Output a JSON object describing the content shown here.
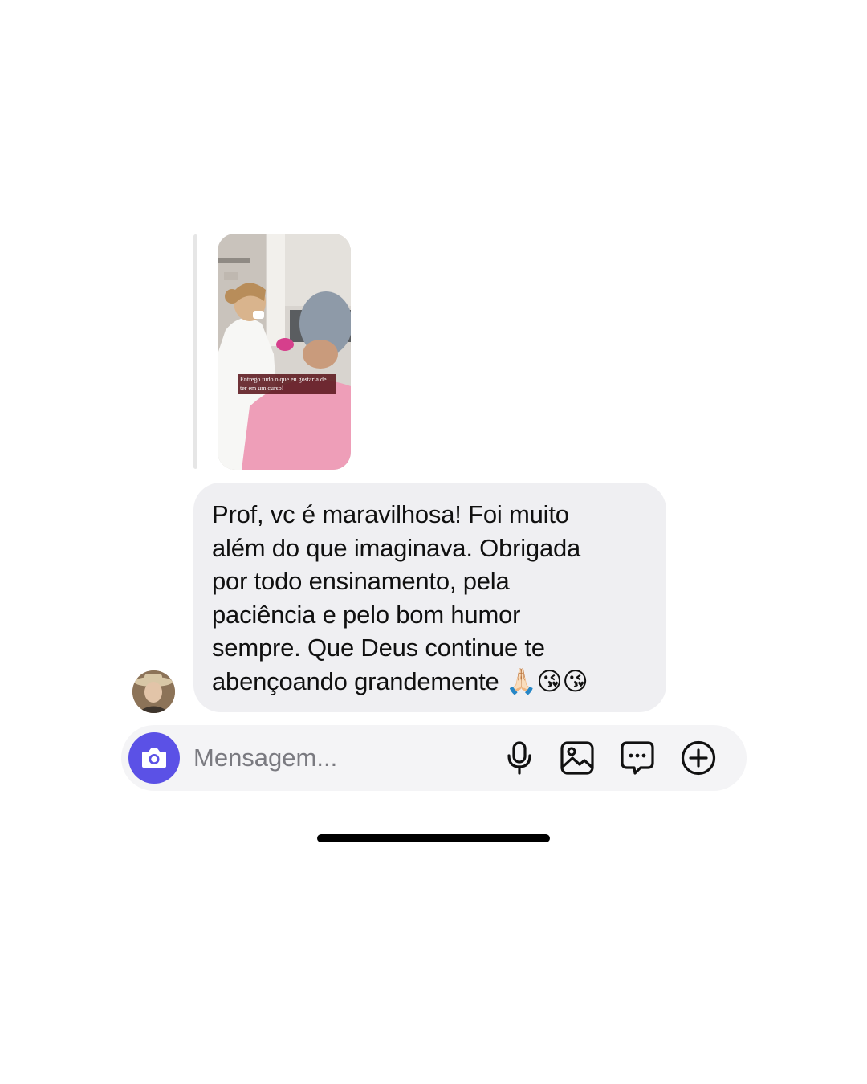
{
  "conversation": {
    "replied_story": {
      "caption": "Entrego tudo o que eu gostaria de ter em um curso!"
    },
    "message": {
      "text": "Prof, vc é maravilhosa! Foi muito\nalém do que imaginava. Obrigada\npor todo ensinamento, pela\npaciência e pelo bom humor\nsempre. Que Deus continue te\nabençoando grandemente 🙏🏻😘😘"
    }
  },
  "composer": {
    "placeholder": "Mensagem...",
    "icons": [
      "camera-icon",
      "microphone-icon",
      "gallery-icon",
      "sticker-icon",
      "plus-icon"
    ],
    "accent_color": "#5b51e6"
  }
}
